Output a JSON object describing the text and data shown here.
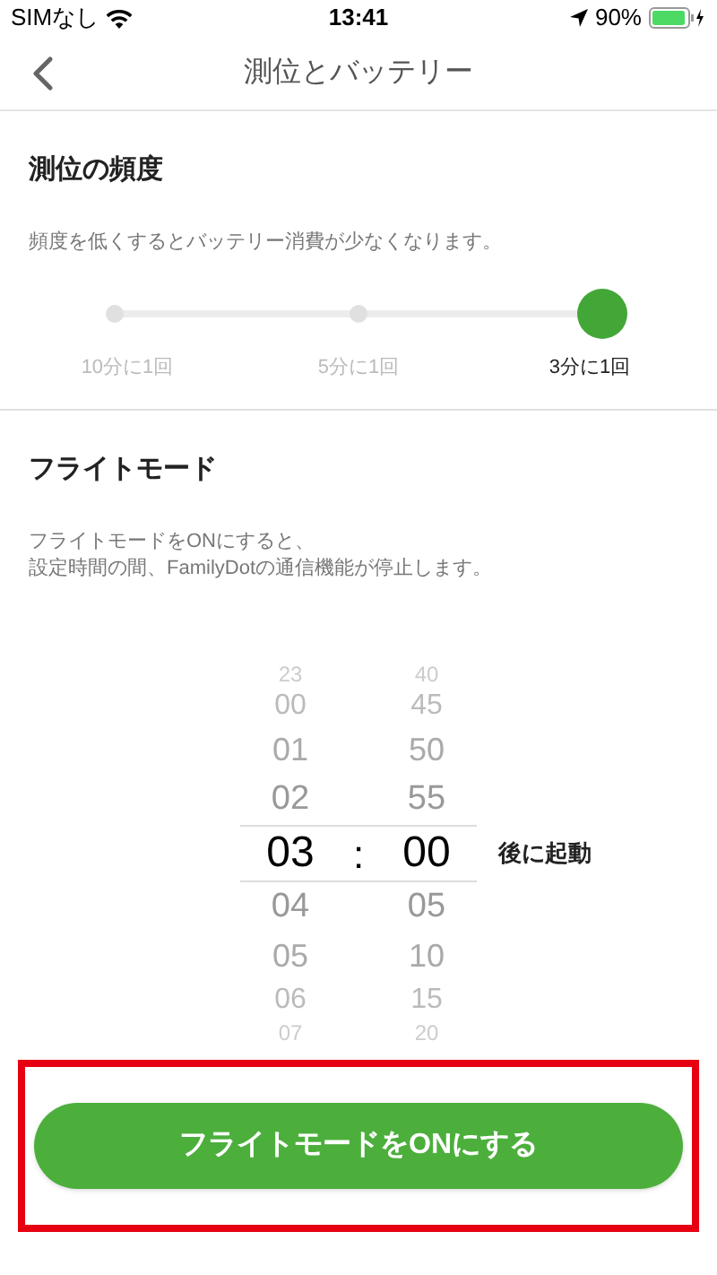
{
  "status_bar": {
    "carrier": "SIMなし",
    "time": "13:41",
    "battery": "90%"
  },
  "nav": {
    "title": "測位とバッテリー"
  },
  "frequency": {
    "heading": "測位の頻度",
    "description": "頻度を低くするとバッテリー消費が少なくなります。",
    "options": [
      {
        "label": "10分に1回",
        "selected": false
      },
      {
        "label": "5分に1回",
        "selected": false
      },
      {
        "label": "3分に1回",
        "selected": true
      }
    ]
  },
  "flight_mode": {
    "heading": "フライトモード",
    "description": [
      "フライトモードをONにすると、",
      "設定時間の間、FamilyDotの通信機能が停止します。"
    ],
    "picker": {
      "hours": [
        {
          "label": "23",
          "selected": false
        },
        {
          "label": "00",
          "selected": false
        },
        {
          "label": "01",
          "selected": false
        },
        {
          "label": "02",
          "selected": false
        },
        {
          "label": "03",
          "selected": true
        },
        {
          "label": "04",
          "selected": false
        },
        {
          "label": "05",
          "selected": false
        },
        {
          "label": "06",
          "selected": false
        },
        {
          "label": "07",
          "selected": false
        }
      ],
      "separator": ":",
      "minutes": [
        {
          "label": "40",
          "selected": false
        },
        {
          "label": "45",
          "selected": false
        },
        {
          "label": "50",
          "selected": false
        },
        {
          "label": "55",
          "selected": false
        },
        {
          "label": "00",
          "selected": true
        },
        {
          "label": "05",
          "selected": false
        },
        {
          "label": "10",
          "selected": false
        },
        {
          "label": "15",
          "selected": false
        },
        {
          "label": "20",
          "selected": false
        }
      ],
      "suffix": "後に起動"
    },
    "button": "フライトモードをONにする"
  }
}
